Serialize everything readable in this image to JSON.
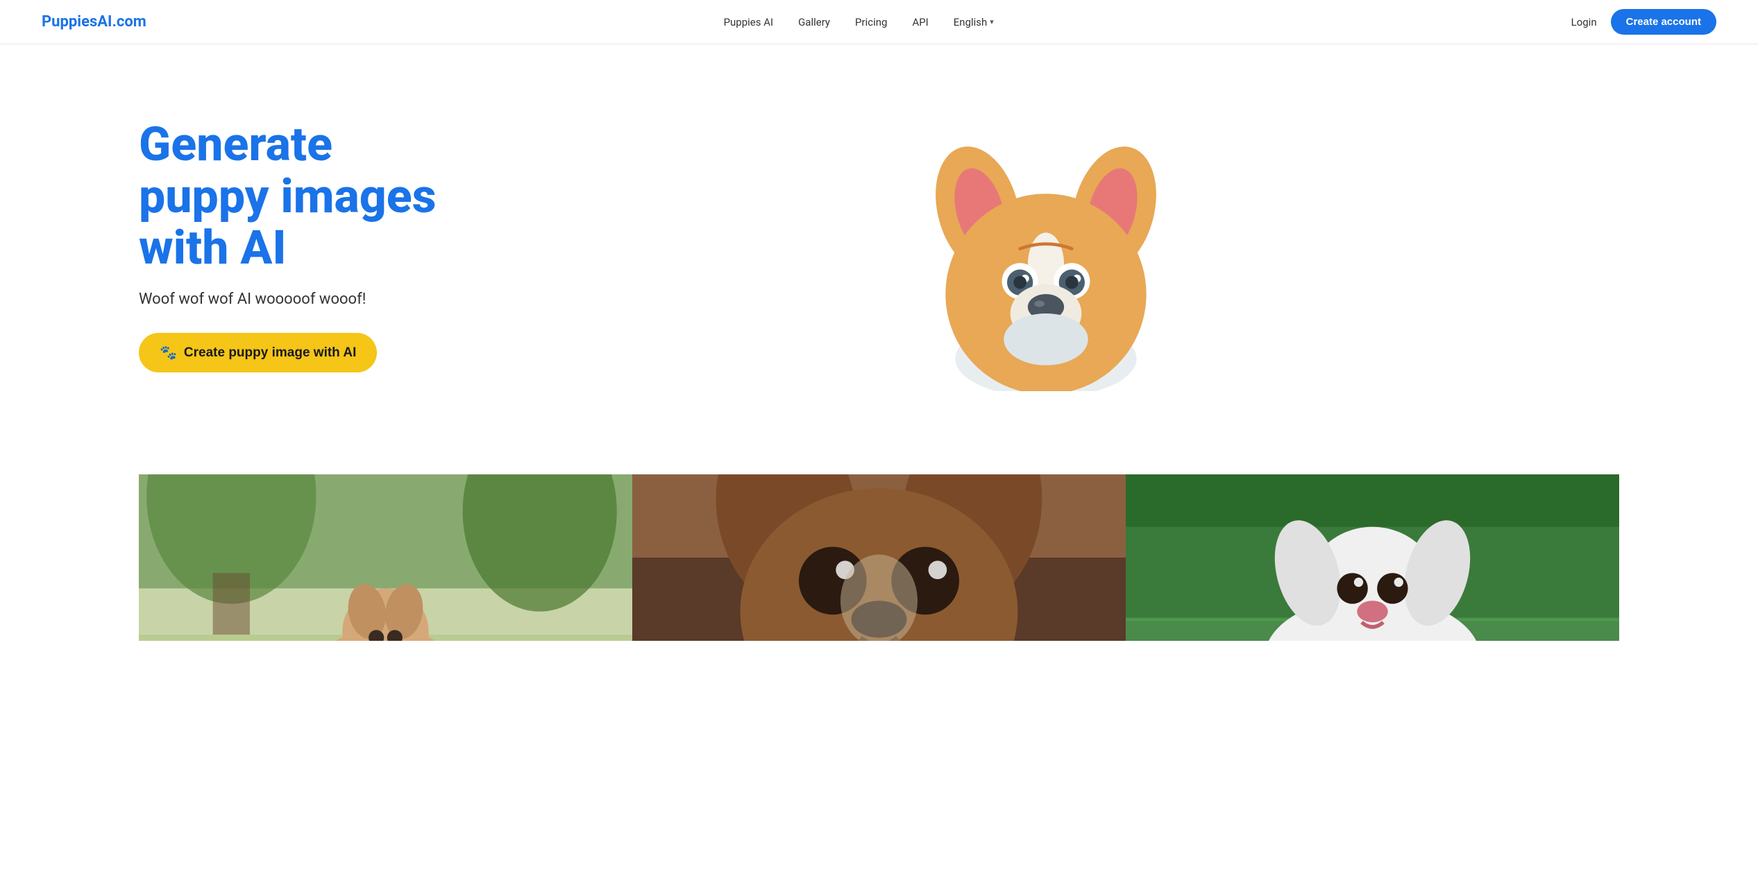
{
  "navbar": {
    "logo": "PuppiesAI.com",
    "links": [
      {
        "label": "Puppies AI",
        "id": "puppies-ai"
      },
      {
        "label": "Gallery",
        "id": "gallery"
      },
      {
        "label": "Pricing",
        "id": "pricing"
      },
      {
        "label": "API",
        "id": "api"
      }
    ],
    "language": "English",
    "login_label": "Login",
    "create_account_label": "Create account"
  },
  "hero": {
    "title": "Generate puppy images with AI",
    "subtitle": "Woof wof wof AI wooooof wooof!",
    "cta_label": "Create puppy image with AI",
    "paw_icon": "🐾"
  },
  "gallery": {
    "images": [
      {
        "alt": "Puppy in park",
        "color": "park"
      },
      {
        "alt": "Brown puppy close-up",
        "color": "brown"
      },
      {
        "alt": "White puppy on grass",
        "color": "grass"
      }
    ]
  },
  "colors": {
    "brand_blue": "#1a73e8",
    "cta_yellow": "#f5c518",
    "title_blue": "#1a73e8"
  }
}
